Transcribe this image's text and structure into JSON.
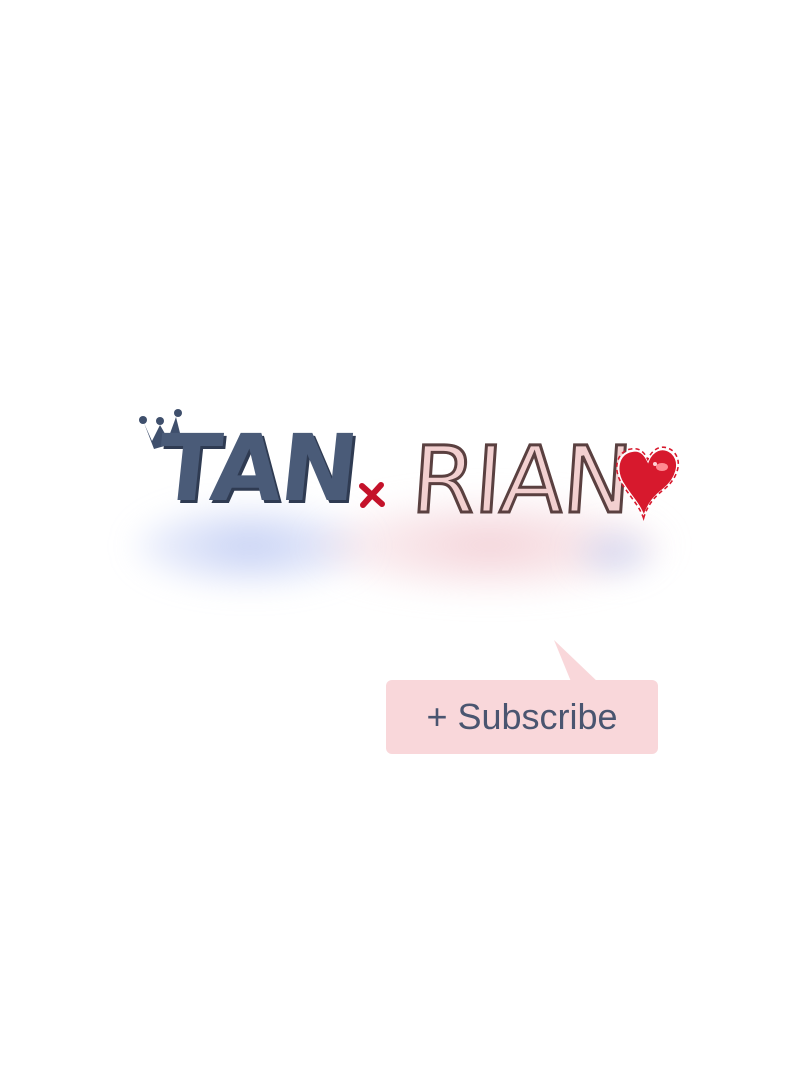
{
  "logo": {
    "part_a": "TAN",
    "separator": "×",
    "part_b": "RIAN"
  },
  "subscribe": {
    "label": "+ Subscribe"
  },
  "colors": {
    "background": "#ffffff",
    "title_a": "#4a5b78",
    "title_b_fill": "#f2d0d0",
    "separator": "#c4122a",
    "heart": "#d7192d",
    "bubble": "#f9d7da",
    "subscribe_text": "#4a5570"
  },
  "icons": [
    "crown-icon",
    "cross-icon",
    "heart-icon"
  ]
}
